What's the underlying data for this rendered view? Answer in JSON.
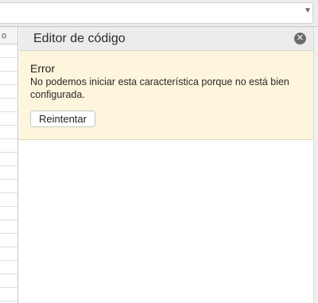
{
  "panel": {
    "title": "Editor de código",
    "close_icon": "close-icon"
  },
  "error": {
    "title": "Error",
    "message": "No podemos iniciar esta característica porque no está bien configurada.",
    "retry_label": "Reintentar"
  },
  "grid": {
    "header_fragment": "o"
  },
  "toolbar": {
    "dropdown_icon": "chevron-down-icon"
  }
}
